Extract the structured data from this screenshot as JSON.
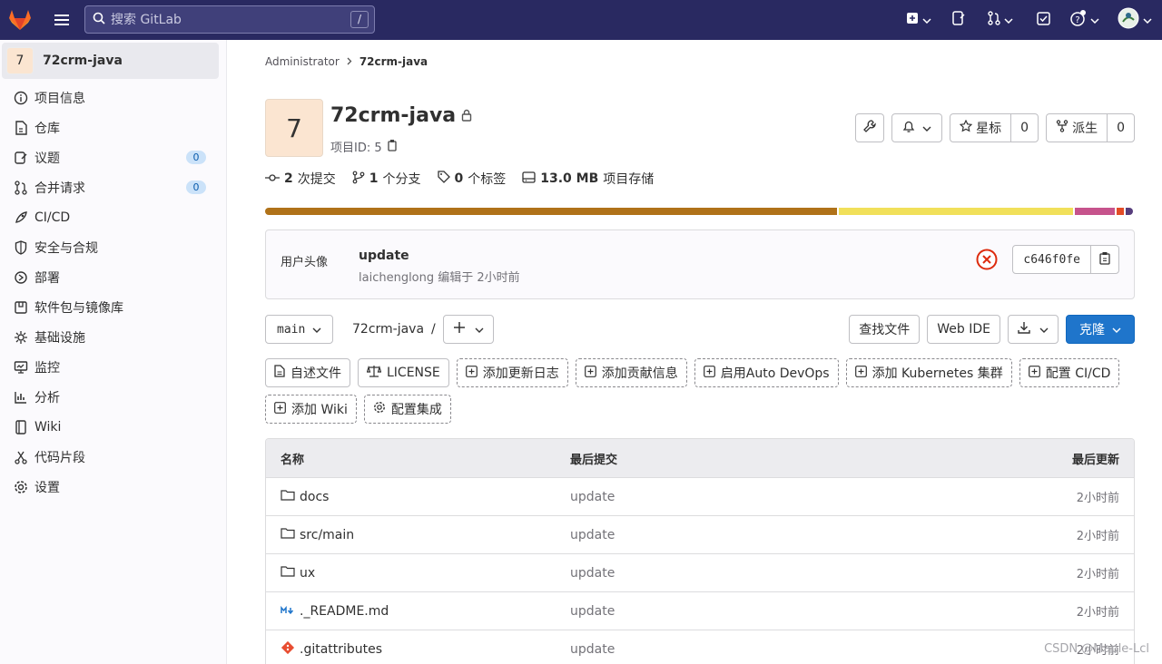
{
  "topbar": {
    "search_placeholder": "搜索 GitLab",
    "search_shortcut": "/"
  },
  "sidebar": {
    "project_avatar": "7",
    "project_name": "72crm-java",
    "items": [
      {
        "label": "项目信息",
        "icon": "info-icon"
      },
      {
        "label": "仓库",
        "icon": "repository-icon"
      },
      {
        "label": "议题",
        "icon": "issues-icon",
        "badge": "0"
      },
      {
        "label": "合并请求",
        "icon": "merge-request-icon",
        "badge": "0"
      },
      {
        "label": "CI/CD",
        "icon": "rocket-icon"
      },
      {
        "label": "安全与合规",
        "icon": "shield-icon"
      },
      {
        "label": "部署",
        "icon": "deployments-icon"
      },
      {
        "label": "软件包与镜像库",
        "icon": "package-icon"
      },
      {
        "label": "基础设施",
        "icon": "cloud-gear-icon"
      },
      {
        "label": "监控",
        "icon": "monitor-icon"
      },
      {
        "label": "分析",
        "icon": "chart-icon"
      },
      {
        "label": "Wiki",
        "icon": "book-icon"
      },
      {
        "label": "代码片段",
        "icon": "snippet-icon"
      },
      {
        "label": "设置",
        "icon": "settings-icon"
      }
    ]
  },
  "breadcrumb": {
    "parent": "Administrator",
    "current": "72crm-java"
  },
  "project": {
    "avatar_letter": "7",
    "title": "72crm-java",
    "project_id": "项目ID: 5",
    "star_label": "星标",
    "star_count": "0",
    "fork_label": "派生",
    "fork_count": "0"
  },
  "stats": {
    "commits_count": "2",
    "commits_label": "次提交",
    "branches_count": "1",
    "branches_label": "个分支",
    "tags_count": "0",
    "tags_label": "个标签",
    "storage_size": "13.0 MB",
    "storage_label": "项目存储"
  },
  "language_bar_colors": [
    "#b07219",
    "#f1e05a",
    "#c6538c",
    "#e34c26",
    "#563d7c"
  ],
  "commit": {
    "avatar_alt": "用户头像",
    "title": "update",
    "meta": "laichenglong 编辑于 2小时前",
    "sha": "c646f0fe",
    "status_color": "#dd2b0e"
  },
  "repo_nav": {
    "branch": "main",
    "path": "72crm-java",
    "path_sep": "/",
    "find_file": "查找文件",
    "web_ide": "Web IDE",
    "clone": "克隆"
  },
  "quick_actions": {
    "row1": [
      {
        "label": "自述文件",
        "icon": "file-icon",
        "dashed": false
      },
      {
        "label": "LICENSE",
        "icon": "scale-icon",
        "dashed": false
      },
      {
        "label": "添加更新日志",
        "icon": "plus-square-icon",
        "dashed": true
      },
      {
        "label": "添加贡献信息",
        "icon": "plus-square-icon",
        "dashed": true
      },
      {
        "label": "启用Auto DevOps",
        "icon": "plus-square-icon",
        "dashed": true
      },
      {
        "label": "添加 Kubernetes 集群",
        "icon": "plus-square-icon",
        "dashed": true
      },
      {
        "label": "配置 CI/CD",
        "icon": "plus-square-icon",
        "dashed": true
      }
    ],
    "row2": [
      {
        "label": "添加 Wiki",
        "icon": "plus-square-icon",
        "dashed": true
      },
      {
        "label": "配置集成",
        "icon": "settings-icon",
        "dashed": true
      }
    ]
  },
  "file_table": {
    "headers": {
      "name": "名称",
      "last_commit": "最后提交",
      "last_update": "最后更新"
    },
    "rows": [
      {
        "name": "docs",
        "type": "folder",
        "commit": "update",
        "updated": "2小时前"
      },
      {
        "name": "src/main",
        "type": "folder",
        "commit": "update",
        "updated": "2小时前"
      },
      {
        "name": "ux",
        "type": "folder",
        "commit": "update",
        "updated": "2小时前"
      },
      {
        "name": "._README.md",
        "type": "markdown",
        "commit": "update",
        "updated": "2小时前"
      },
      {
        "name": ".gitattributes",
        "type": "git",
        "commit": "update",
        "updated": "2小时前"
      }
    ]
  },
  "watermark": "CSDN @Maple-Lcl"
}
